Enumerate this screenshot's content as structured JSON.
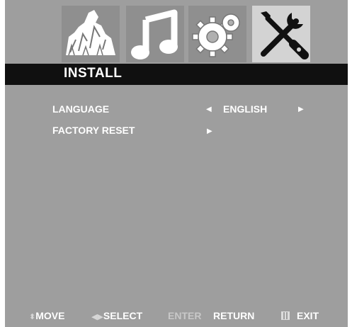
{
  "menu_icons": [
    {
      "name": "picture",
      "icon": "picture-icon",
      "selected": false
    },
    {
      "name": "sound",
      "icon": "music-note-icon",
      "selected": false
    },
    {
      "name": "setup",
      "icon": "gear-icon",
      "selected": false
    },
    {
      "name": "install",
      "icon": "tools-icon",
      "selected": true
    }
  ],
  "header": {
    "title": "INSTALL"
  },
  "items": [
    {
      "label": "LANGUAGE",
      "value": "ENGLISH"
    },
    {
      "label": "FACTORY RESET",
      "value": ""
    }
  ],
  "footer": {
    "move": "MOVE",
    "select": "SELECT",
    "enter": "ENTER",
    "return": "RETURN",
    "exit": "EXIT"
  },
  "colors": {
    "panel": "#9e9e9e",
    "title_bar": "#101010",
    "selected_icon_bg": "#d3d3d3",
    "text": "#ffffff"
  }
}
